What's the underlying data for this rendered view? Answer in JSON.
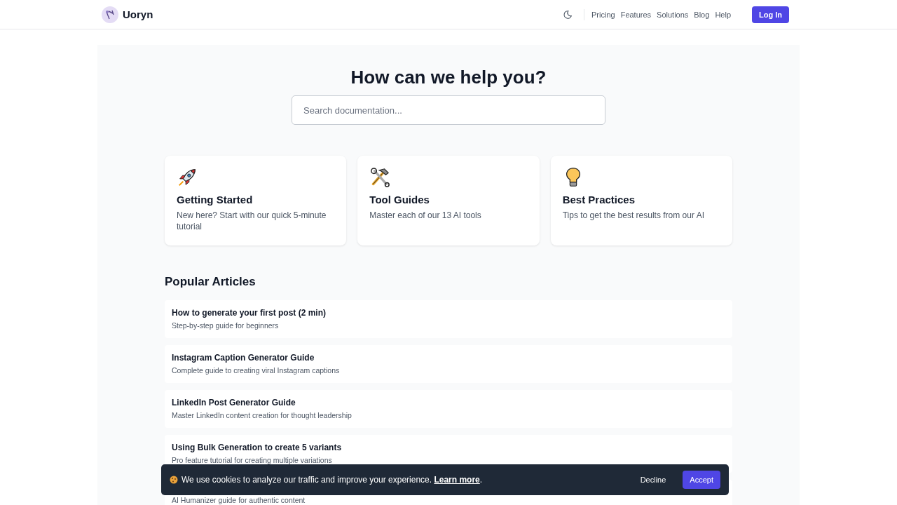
{
  "header": {
    "brand": "Uoryn",
    "nav": [
      {
        "label": "Pricing"
      },
      {
        "label": "Features"
      },
      {
        "label": "Solutions"
      },
      {
        "label": "Blog"
      },
      {
        "label": "Help"
      }
    ],
    "login": "Log In"
  },
  "hero": {
    "title": "How can we help you?",
    "search": {
      "placeholder": "Search documentation..."
    }
  },
  "cards": [
    {
      "kind": "rocket",
      "title": "Getting Started",
      "text": "New here? Start with our quick 5-minute tutorial"
    },
    {
      "kind": "tools",
      "title": "Tool Guides",
      "text": "Master each of our 13 AI tools"
    },
    {
      "kind": "bulb",
      "title": "Best Practices",
      "text": "Tips to get the best results from our AI"
    }
  ],
  "popular": {
    "heading": "Popular Articles",
    "articles": [
      {
        "title": "How to generate your first post (2 min)",
        "text": "Step-by-step guide for beginners"
      },
      {
        "title": "Instagram Caption Generator Guide",
        "text": "Complete guide to creating viral Instagram captions"
      },
      {
        "title": "LinkedIn Post Generator Guide",
        "text": "Master LinkedIn content creation for thought leadership"
      },
      {
        "title": "Using Bulk Generation to create 5 variants",
        "text": "Pro feature tutorial for creating multiple variations"
      },
      {
        "text": "AI Humanizer guide for authentic content"
      }
    ]
  },
  "cookie_banner": {
    "message": "We use cookies to analyze our traffic and improve your experience.",
    "link": "Learn more",
    "after_link": ".",
    "decline": "Decline",
    "accept": "Accept"
  }
}
